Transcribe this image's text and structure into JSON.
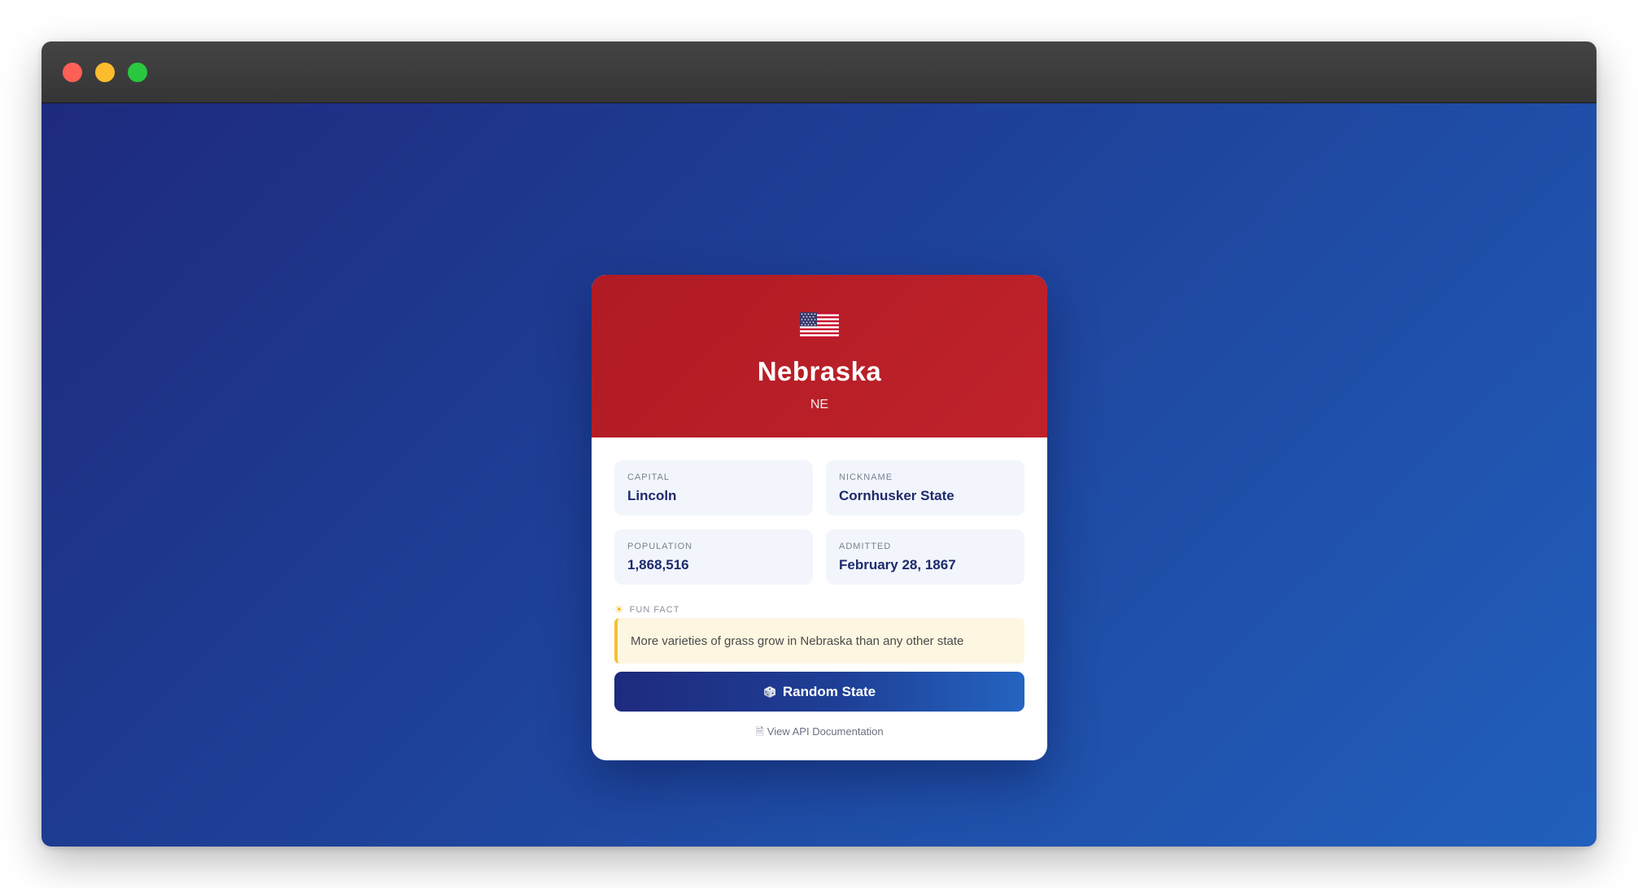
{
  "window": {
    "controls": [
      "close",
      "minimize",
      "maximize"
    ]
  },
  "state": {
    "flag_icon": "us-flag-icon",
    "name": "Nebraska",
    "abbreviation": "NE"
  },
  "info": [
    {
      "label": "CAPITAL",
      "value": "Lincoln"
    },
    {
      "label": "NICKNAME",
      "value": "Cornhusker State"
    },
    {
      "label": "POPULATION",
      "value": "1,868,516"
    },
    {
      "label": "ADMITTED",
      "value": "February 28, 1867"
    }
  ],
  "fun_fact": {
    "icon": "sun-icon",
    "label": "FUN FACT",
    "text": "More varieties of grass grow in Nebraska than any other state"
  },
  "actions": {
    "random_icon": "dice-icon",
    "random_label": "Random State",
    "api_icon": "document-icon",
    "api_label": "View API Documentation"
  },
  "colors": {
    "header_red": "#b01b24",
    "navy": "#1e2a7e",
    "blue": "#2160bd",
    "fact_accent": "#f2c230"
  }
}
